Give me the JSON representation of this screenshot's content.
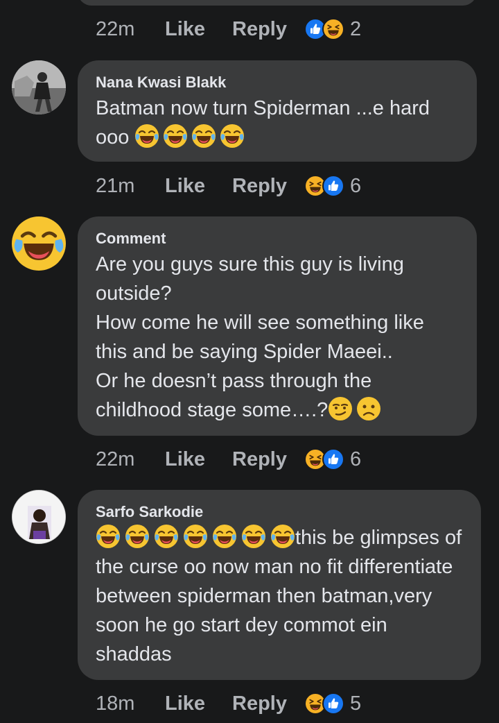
{
  "comments": [
    {
      "meta": {
        "time": "22m",
        "like": "Like",
        "reply": "Reply",
        "reactions": [
          "like",
          "haha"
        ],
        "count": "2"
      }
    },
    {
      "author": "Nana Kwasi Blakk",
      "text": "Batman now turn Spiderman ...e hard ooo",
      "emojis": [
        "joy-emoji",
        "joy-emoji",
        "joy-emoji",
        "joy-emoji"
      ],
      "meta": {
        "time": "21m",
        "like": "Like",
        "reply": "Reply",
        "reactions": [
          "haha",
          "like"
        ],
        "count": "6"
      }
    },
    {
      "author": "Comment",
      "text": "Are you guys sure this guy is living outside?\nHow come he will see something like this and be saying Spider Maeei..\nOr he doesn’t pass through the childhood stage some….?",
      "emojis": [
        "smirk-emoji",
        "frown-emoji"
      ],
      "meta": {
        "time": "22m",
        "like": "Like",
        "reply": "Reply",
        "reactions": [
          "haha",
          "like"
        ],
        "count": "6"
      }
    },
    {
      "author": "Sarfo Sarkodie",
      "text": "this be glimpses of the curse oo now man no fit differentiate between spiderman then batman,very soon he go start dey commot ein shaddas",
      "emojis": [
        "joy-emoji",
        "joy-emoji",
        "joy-emoji",
        "joy-emoji",
        "joy-emoji",
        "joy-emoji",
        "joy-emoji"
      ],
      "meta": {
        "time": "18m",
        "like": "Like",
        "reply": "Reply",
        "reactions": [
          "haha",
          "like"
        ],
        "count": "5"
      }
    }
  ],
  "colors": {
    "background": "#18191a",
    "bubble": "#3a3b3c",
    "text": "#e4e6eb",
    "muted": "#b0b3b8",
    "like_blue": "#1877f2",
    "haha_yellow": "#f7b125"
  }
}
